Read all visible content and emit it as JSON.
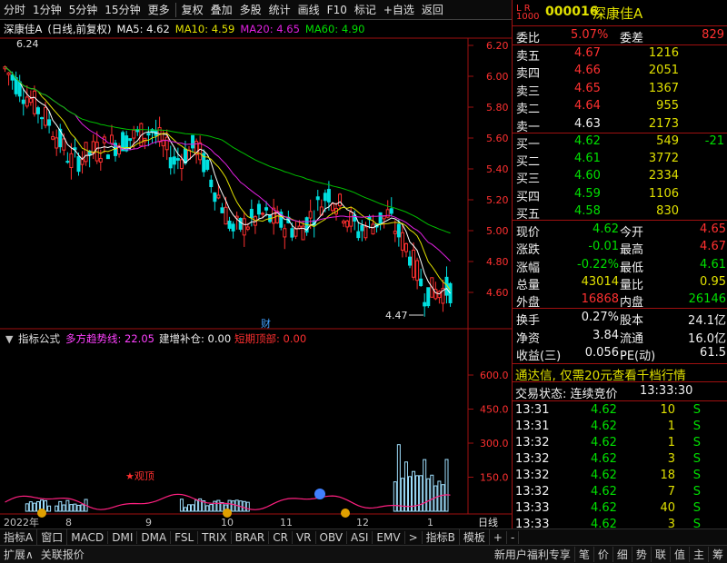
{
  "toolbar": {
    "items": [
      "分时",
      "1分钟",
      "5分钟",
      "15分钟",
      "更多",
      "复权",
      "叠加",
      "多股",
      "统计",
      "画线",
      "F10",
      "标记",
      "+自选",
      "返回"
    ]
  },
  "chart_title": {
    "stock": "深康佳A",
    "mode": "(日线,前复权)",
    "ma5": "MA5: 4.62",
    "ma10": "MA10: 4.59",
    "ma20": "MA20: 4.65",
    "ma60": "MA60: 4.90"
  },
  "price_axis": [
    "6.20",
    "6.00",
    "5.80",
    "5.60",
    "5.40",
    "5.20",
    "5.00",
    "4.80",
    "4.60"
  ],
  "price_high_label": "6.24",
  "price_low_label": "4.47",
  "cai_label": "财",
  "indicator_title": {
    "name": "指标公式",
    "line1": "多方趋势线: 22.05",
    "line2": "建增补仓: 0.00",
    "line3": "短期顶部: 0.00"
  },
  "indicator_axis": [
    "600.0",
    "450.0",
    "300.0",
    "150.0"
  ],
  "indicator_marker": "★观顶",
  "date_axis": {
    "year": "2022年",
    "months": [
      "8",
      "9",
      "10",
      "11",
      "12",
      "1"
    ],
    "period": "日线"
  },
  "chart_data": {
    "type": "candlestick",
    "title": "深康佳A (日线,前复权)",
    "ylim": [
      4.4,
      6.3
    ],
    "series": [
      {
        "name": "MA5",
        "value": 4.62
      },
      {
        "name": "MA10",
        "value": 4.59
      },
      {
        "name": "MA20",
        "value": 4.65
      },
      {
        "name": "MA60",
        "value": 4.9
      }
    ],
    "annotations": [
      "6.24",
      "4.47"
    ],
    "indicator": {
      "name": "指标公式",
      "ylim": [
        0,
        700
      ],
      "ticks": [
        600.0,
        450.0,
        300.0,
        150.0
      ]
    }
  },
  "stock_header": {
    "code": "000016",
    "name": "深康佳A"
  },
  "weibi": {
    "label1": "委比",
    "value1": "5.07%",
    "label2": "委差",
    "value2": "829"
  },
  "asks": [
    {
      "label": "卖五",
      "price": "4.67",
      "vol": "1216"
    },
    {
      "label": "卖四",
      "price": "4.66",
      "vol": "2051"
    },
    {
      "label": "卖三",
      "price": "4.65",
      "vol": "1367"
    },
    {
      "label": "卖二",
      "price": "4.64",
      "vol": "955"
    },
    {
      "label": "卖一",
      "price": "4.63",
      "vol": "2173"
    }
  ],
  "bids": [
    {
      "label": "买一",
      "price": "4.62",
      "vol": "549",
      "chg": "-21"
    },
    {
      "label": "买二",
      "price": "4.61",
      "vol": "3772",
      "chg": ""
    },
    {
      "label": "买三",
      "price": "4.60",
      "vol": "2334",
      "chg": ""
    },
    {
      "label": "买四",
      "price": "4.59",
      "vol": "1106",
      "chg": ""
    },
    {
      "label": "买五",
      "price": "4.58",
      "vol": "830",
      "chg": ""
    }
  ],
  "quote": [
    {
      "l1": "现价",
      "v1": "4.62",
      "l2": "今开",
      "v2": "4.65"
    },
    {
      "l1": "涨跌",
      "v1": "-0.01",
      "l2": "最高",
      "v2": "4.67"
    },
    {
      "l1": "涨幅",
      "v1": "-0.22%",
      "l2": "最低",
      "v2": "4.61"
    },
    {
      "l1": "总量",
      "v1": "43014",
      "l2": "量比",
      "v2": "0.95"
    },
    {
      "l1": "外盘",
      "v1": "16868",
      "l2": "内盘",
      "v2": "26146"
    }
  ],
  "fundamentals": [
    {
      "l1": "换手",
      "v1": "0.27%",
      "l2": "股本",
      "v2": "24.1亿"
    },
    {
      "l1": "净资",
      "v1": "3.84",
      "l2": "流通",
      "v2": "16.0亿"
    },
    {
      "l1": "收益(三)",
      "v1": "0.056",
      "l2": "PE(动)",
      "v2": "61.5"
    }
  ],
  "promo": "通达信, 仅需20元查看千档行情",
  "trade_status": {
    "label": "交易状态: 连续竞价",
    "time": "13:33:30"
  },
  "ticks": [
    {
      "time": "13:31",
      "price": "4.62",
      "vol": "10",
      "side": "S"
    },
    {
      "time": "13:31",
      "price": "4.62",
      "vol": "1",
      "side": "S"
    },
    {
      "time": "13:32",
      "price": "4.62",
      "vol": "1",
      "side": "S"
    },
    {
      "time": "13:32",
      "price": "4.62",
      "vol": "3",
      "side": "S"
    },
    {
      "time": "13:32",
      "price": "4.62",
      "vol": "18",
      "side": "S"
    },
    {
      "time": "13:32",
      "price": "4.62",
      "vol": "7",
      "side": "S"
    },
    {
      "time": "13:33",
      "price": "4.62",
      "vol": "40",
      "side": "S"
    },
    {
      "time": "13:33",
      "price": "4.62",
      "vol": "3",
      "side": "S"
    }
  ],
  "bottom_tabs": [
    "指标A",
    "窗口",
    "MACD",
    "DMI",
    "DMA",
    "FSL",
    "TRIX",
    "BRAR",
    "CR",
    "VR",
    "OBV",
    "ASI",
    "EMV",
    ">",
    "指标B",
    "模板",
    "+",
    "-"
  ],
  "status_left": [
    "扩展∧",
    "关联报价"
  ],
  "status_right": [
    "新用户福利专享",
    "笔",
    "价",
    "细",
    "势",
    "联",
    "值",
    "主",
    "筹"
  ],
  "colors": {
    "up": "#ff3030",
    "down": "#00e0e0",
    "ma5": "#ffffff",
    "ma10": "#e0e000",
    "ma20": "#e020e0",
    "ma60": "#00c000",
    "frame": "#a01010"
  }
}
